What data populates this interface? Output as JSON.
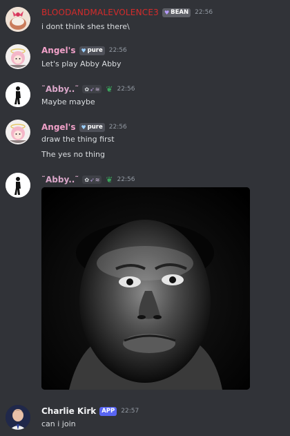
{
  "messages": [
    {
      "user": "BLOODANDMALEVOLENCE3",
      "user_color": "#d52b2b",
      "tag": "BEAN",
      "tag_icon": "heart-icon",
      "timestamp": "22:56",
      "lines": [
        "i dont think shes there\\"
      ]
    },
    {
      "user": "Angel's",
      "user_color": "#f0a0c8",
      "tag": "pure",
      "tag_icon": "heart-icon",
      "timestamp": "22:56",
      "lines": [
        "Let's play Abby Abby"
      ]
    },
    {
      "user": "˜Abby..˜",
      "user_color": "#d9a6c8",
      "badges": [
        "flower-icon",
        "feather-icon",
        "wing-icon"
      ],
      "status_icon": "leaf-icon",
      "timestamp": "22:56",
      "lines": [
        "Maybe maybe"
      ]
    },
    {
      "user": "Angel's",
      "user_color": "#f0a0c8",
      "tag": "pure",
      "tag_icon": "heart-icon",
      "timestamp": "22:56",
      "lines": [
        "draw the thing first",
        "The yes no thing"
      ]
    },
    {
      "user": "˜Abby..˜",
      "user_color": "#d9a6c8",
      "badges": [
        "flower-icon",
        "feather-icon",
        "wing-icon"
      ],
      "status_icon": "leaf-icon",
      "timestamp": "22:56",
      "attachment": "photo"
    },
    {
      "user": "Charlie Kirk",
      "user_color": "#f2f3f5",
      "tag": "APP",
      "timestamp": "22:57",
      "lines": [
        "can i join"
      ]
    }
  ],
  "colors": {
    "background": "#313338",
    "text": "#dbdee1",
    "timestamp": "#949ba4",
    "app_badge": "#5865f2"
  }
}
